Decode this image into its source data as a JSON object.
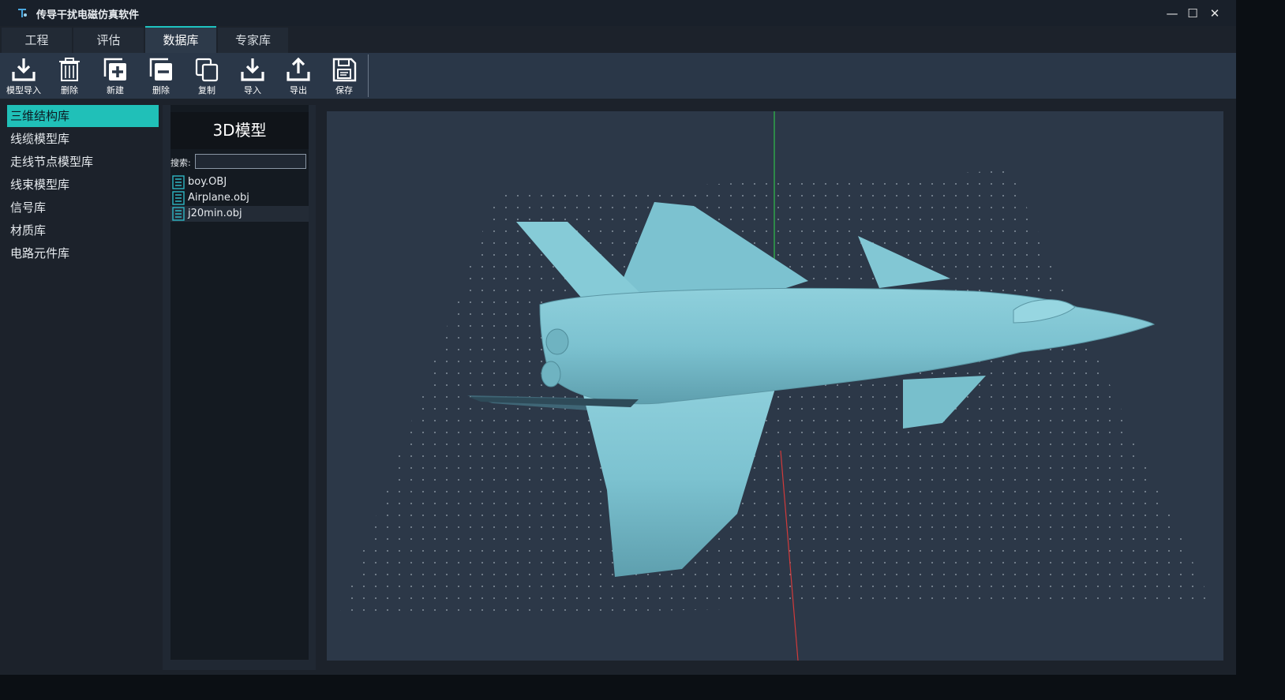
{
  "app": {
    "title": "传导干扰电磁仿真软件",
    "window_controls": {
      "minimize": "—",
      "maximize": "☐",
      "close": "✕"
    }
  },
  "tabs": [
    {
      "label": "工程",
      "active": false
    },
    {
      "label": "评估",
      "active": false
    },
    {
      "label": "数据库",
      "active": true
    },
    {
      "label": "专家库",
      "active": false
    }
  ],
  "toolbar": {
    "buttons": [
      {
        "label": "模型导入",
        "icon": "download-icon"
      },
      {
        "label": "删除",
        "icon": "trash-icon"
      },
      {
        "label": "新建",
        "icon": "new-icon"
      },
      {
        "label": "删除",
        "icon": "remove-icon"
      },
      {
        "label": "复制",
        "icon": "copy-icon"
      },
      {
        "label": "导入",
        "icon": "import-icon"
      },
      {
        "label": "导出",
        "icon": "export-icon"
      },
      {
        "label": "保存",
        "icon": "save-icon"
      }
    ]
  },
  "sidebar": {
    "items": [
      {
        "label": "三维结构库",
        "active": true
      },
      {
        "label": "线缆模型库",
        "active": false
      },
      {
        "label": "走线节点模型库",
        "active": false
      },
      {
        "label": "线束模型库",
        "active": false
      },
      {
        "label": "信号库",
        "active": false
      },
      {
        "label": "材质库",
        "active": false
      },
      {
        "label": "电路元件库",
        "active": false
      }
    ]
  },
  "model_panel": {
    "title": "3D模型",
    "search_label": "搜索:",
    "search_value": "",
    "files": [
      {
        "name": "boy.OBJ",
        "selected": false
      },
      {
        "name": "Airplane.obj",
        "selected": false
      },
      {
        "name": "j20min.obj",
        "selected": true
      }
    ]
  },
  "viewport": {
    "model": "fighter-jet",
    "model_color": "#7cc2d0",
    "background": "#2c3848",
    "axis_colors": {
      "y": "#2fbf4a",
      "x": "#d23a3a"
    }
  },
  "colors": {
    "accent": "#20c0b8",
    "toolbar_bg": "#2a3748"
  }
}
